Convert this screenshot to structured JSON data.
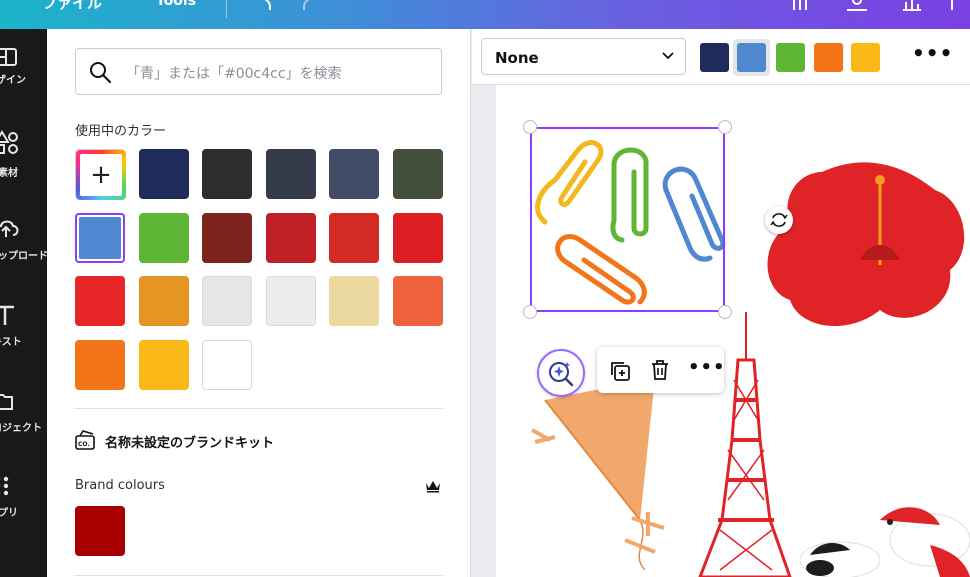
{
  "topbar": {
    "file_label": "ファイル",
    "tools_label": "Tools"
  },
  "rail": {
    "items": [
      {
        "label": "デザイン",
        "icon": "layout-icon"
      },
      {
        "label": "素材",
        "icon": "elements-icon"
      },
      {
        "label": "アップロード",
        "icon": "upload-icon"
      },
      {
        "label": "テキスト",
        "icon": "text-icon"
      },
      {
        "label": "プロジェクト",
        "icon": "folder-icon"
      },
      {
        "label": "アプリ",
        "icon": "apps-icon"
      }
    ]
  },
  "panel": {
    "search_placeholder": "「青」または「#00c4cc」を検索",
    "in_use_title": "使用中のカラー",
    "in_use_colors": [
      "add",
      "#1f2b5a",
      "#2d2d2d",
      "#353b4a",
      "#414b66",
      "#434f3a",
      "#4f87d0",
      "#5fb534",
      "#7c231d",
      "#c11f26",
      "#d32a23",
      "#dc1f25",
      "#e62626",
      "#e69424",
      "#e6e6e6",
      "#ececec",
      "#ecd9a0",
      "#f0623b",
      "#f47419",
      "#fbb917",
      "#ffffff"
    ],
    "selected_color": "#4f87d0",
    "brand_kit_label": "名称未設定のブランドキット",
    "brand_colours_label": "Brand colours",
    "brand_colors": [
      "#a80000"
    ]
  },
  "toolbar": {
    "dropdown_value": "None",
    "colors": [
      "#1f2b5a",
      "#4f87d0",
      "#5fb534",
      "#f47419",
      "#fbb917"
    ],
    "selected_color": "#4f87d0"
  },
  "accent": "#8b3dff"
}
